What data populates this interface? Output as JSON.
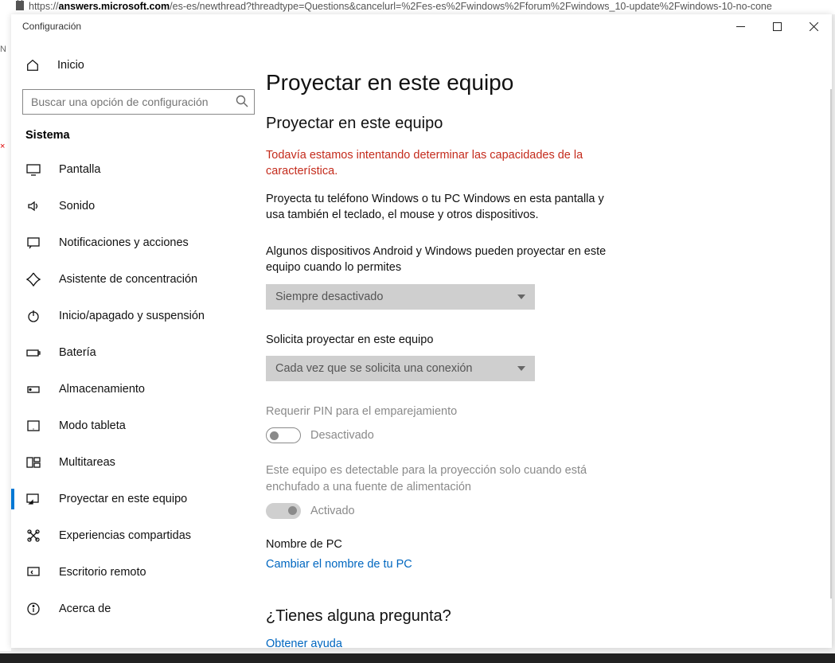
{
  "url": {
    "domain": "answers.microsoft.com",
    "prefix": "https://",
    "path": "/es-es/newthread?threadtype=Questions&cancelurl=%2Fes-es%2Fwindows%2Fforum%2Fwindows_10-update%2Fwindows-10-no-cone"
  },
  "window": {
    "title": "Configuración"
  },
  "sidebar": {
    "home": "Inicio",
    "search_placeholder": "Buscar una opción de configuración",
    "group": "Sistema",
    "items": [
      {
        "label": "Pantalla"
      },
      {
        "label": "Sonido"
      },
      {
        "label": "Notificaciones y acciones"
      },
      {
        "label": "Asistente de concentración"
      },
      {
        "label": "Inicio/apagado y suspensión"
      },
      {
        "label": "Batería"
      },
      {
        "label": "Almacenamiento"
      },
      {
        "label": "Modo tableta"
      },
      {
        "label": "Multitareas"
      },
      {
        "label": "Proyectar en este equipo",
        "selected": true
      },
      {
        "label": "Experiencias compartidas"
      },
      {
        "label": "Escritorio remoto"
      },
      {
        "label": "Acerca de"
      }
    ]
  },
  "main": {
    "pageTitle": "Proyectar en este equipo",
    "sectionTitle": "Proyectar en este equipo",
    "warning": "Todavía estamos intentando determinar las capacidades de la característica.",
    "description": "Proyecta tu teléfono Windows o tu PC Windows en esta pantalla y usa también el teclado, el mouse y otros dispositivos.",
    "setting1_label": "Algunos dispositivos Android y Windows pueden proyectar en este equipo cuando lo permites",
    "setting1_value": "Siempre desactivado",
    "setting2_label": "Solicita proyectar en este equipo",
    "setting2_value": "Cada vez que se solicita una conexión",
    "setting3_label": "Requerir PIN para el emparejamiento",
    "setting3_value": "Desactivado",
    "setting4_label": "Este equipo es detectable para la proyección solo cuando está enchufado a una fuente de alimentación",
    "setting4_value": "Activado",
    "pcname_label": "Nombre de PC",
    "pcname_link": "Cambiar el nombre de tu PC",
    "question_header": "¿Tienes alguna pregunta?",
    "help_link": "Obtener ayuda"
  }
}
